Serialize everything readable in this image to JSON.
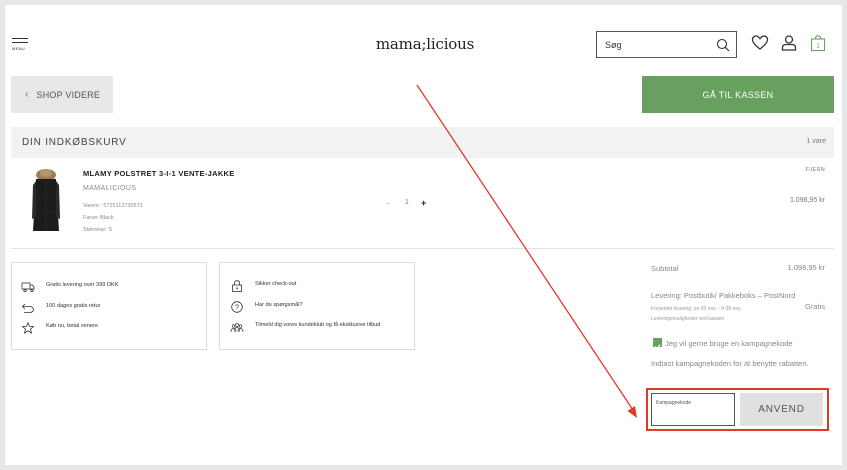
{
  "header": {
    "menu_label": "MENU",
    "logo": "mama;licious",
    "search_placeholder": "Søg",
    "icons": [
      "search-icon",
      "heart-icon",
      "user-icon",
      "bag-icon"
    ],
    "bag_count": "1"
  },
  "actions": {
    "continue_label": "SHOP VIDERE",
    "checkout_label": "GÅ TIL KASSEN"
  },
  "cart": {
    "title": "DIN INDKØBSKURV",
    "count": "1 vare"
  },
  "product": {
    "name": "MLAMY POLSTRET 3-I-1 VENTE-JAKKE",
    "brand": "MAMALICIOUS",
    "sku": "Varenr.: 5715113730571",
    "color": "Farve: Black",
    "size": "Størrelse: S",
    "quantity": "1",
    "remove_label": "FJERN",
    "price": "1.098,95 kr"
  },
  "benefits_left": [
    {
      "icon": "truck-icon",
      "text": "Gratis levering over 399 DKK"
    },
    {
      "icon": "return-arrow-icon",
      "text": "100 dages gratis retur"
    },
    {
      "icon": "star-icon",
      "text": "Køb nu, betal senere"
    }
  ],
  "benefits_right": [
    {
      "icon": "lock-icon",
      "text": "Sikker check-out"
    },
    {
      "icon": "question-icon",
      "text": "Har du spørgsmål?"
    },
    {
      "icon": "people-icon",
      "text": "Tilmeld dig vores kundeklub og få eksklusive tilbud"
    }
  ],
  "summary": {
    "subtotal_label": "Subtotal",
    "subtotal_value": "1.098,95 kr",
    "delivery_label": "Levering: Postbutik/ Pakkeboks – PostNord",
    "delivery_value": "Gratis",
    "delivery_expected": "Forventet levering: on 03 nov. - fr 05 nov.",
    "delivery_options": "Leveringsmuligheder ved kassen",
    "promo_checkbox_label": "Jeg vil gerne bruge en kampagnekode",
    "promo_hint": "Indtast kampagnekoden for at benytte rabatten.",
    "promo_field_label": "Kampagnekode",
    "apply_label": "ANVEND"
  },
  "colors": {
    "accent_green": "#67a05f",
    "annotation_red": "#e03a27"
  }
}
